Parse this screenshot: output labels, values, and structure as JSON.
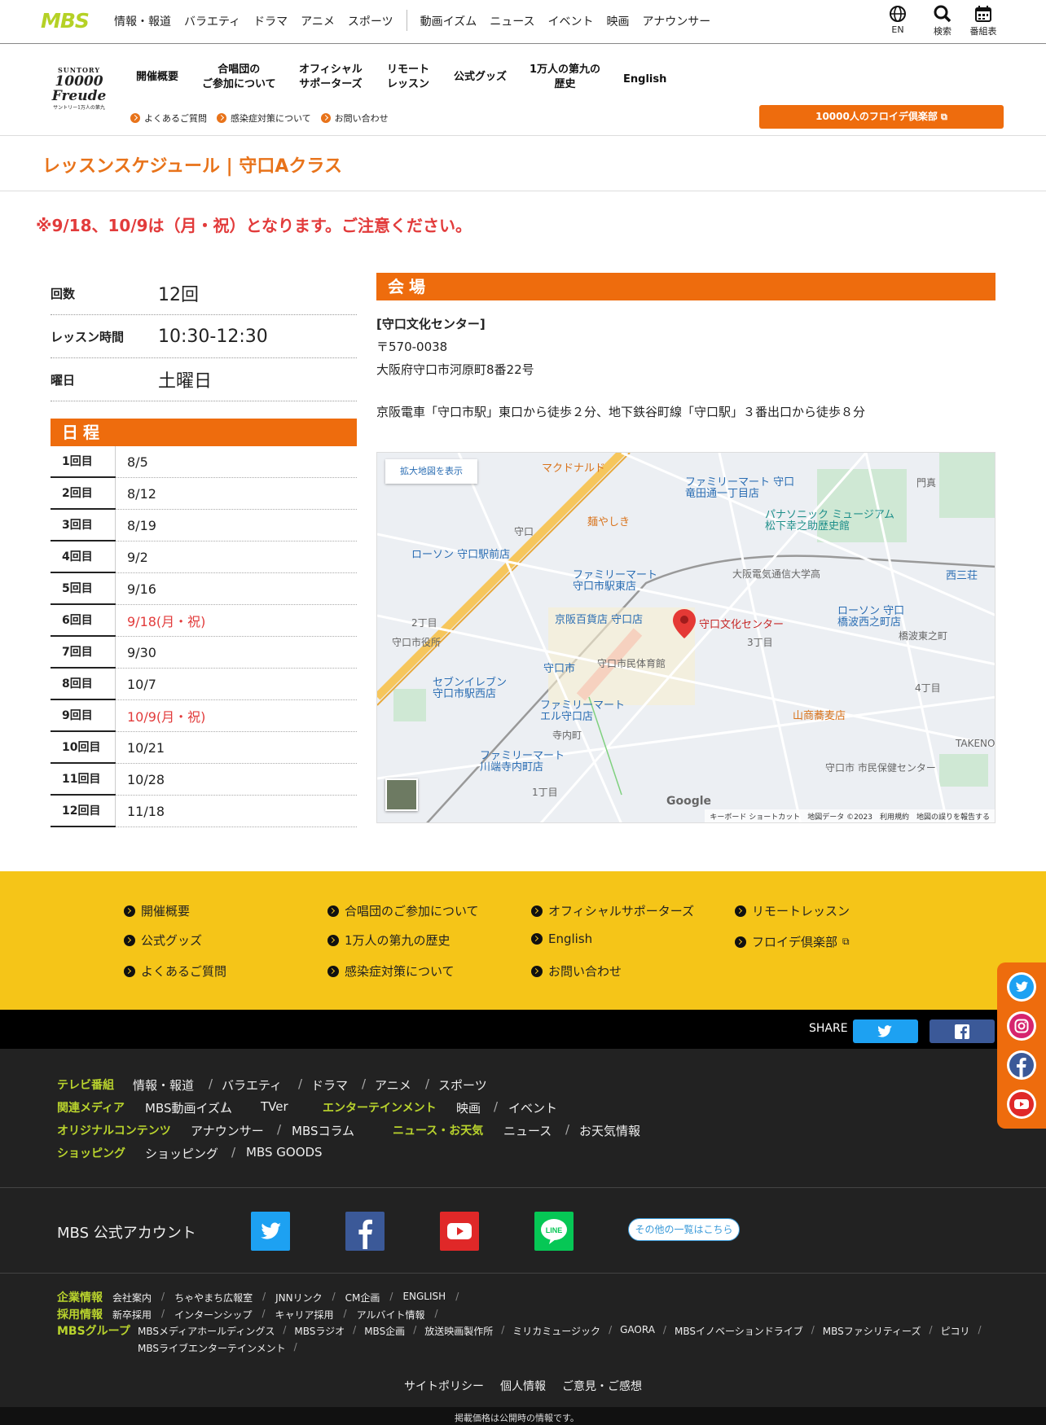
{
  "topbar": {
    "logo": "MBS",
    "nav": [
      "情報・報道",
      "バラエティ",
      "ドラマ",
      "アニメ",
      "スポーツ",
      "動画イズム",
      "ニュース",
      "イベント",
      "映画",
      "アナウンサー"
    ],
    "icons": [
      {
        "name": "globe-icon",
        "label": "EN"
      },
      {
        "name": "search-icon",
        "label": "検索"
      },
      {
        "name": "calendar-icon",
        "label": "番組表"
      }
    ]
  },
  "header": {
    "logo_top": "SUNTORY",
    "logo_main": "10000 Freude",
    "logo_sub": "サントリー1万人の第九",
    "nav": [
      "開催概要",
      "合唱団の\nご参加について",
      "オフィシャル\nサポーターズ",
      "リモート\nレッスン",
      "公式グッズ",
      "1万人の第九の\n歴史",
      "English"
    ],
    "subnav": [
      "よくあるご質問",
      "感染症対策について",
      "お問い合わせ"
    ],
    "club_button": "10000人のフロイデ倶楽部"
  },
  "page": {
    "title": "レッスンスケジュール | 守口Aクラス",
    "notice": "※9/18、10/9は（月・祝）となります。ご注意ください。"
  },
  "info": [
    {
      "label": "回数",
      "value": "12回"
    },
    {
      "label": "レッスン時間",
      "value": "10:30-12:30"
    },
    {
      "label": "曜日",
      "value": "土曜日"
    }
  ],
  "schedule": {
    "heading": "日程",
    "rows": [
      {
        "n": "1回目",
        "d": "8/5",
        "holiday": false
      },
      {
        "n": "2回目",
        "d": "8/12",
        "holiday": false
      },
      {
        "n": "3回目",
        "d": "8/19",
        "holiday": false
      },
      {
        "n": "4回目",
        "d": "9/2",
        "holiday": false
      },
      {
        "n": "5回目",
        "d": "9/16",
        "holiday": false
      },
      {
        "n": "6回目",
        "d": "9/18(月・祝)",
        "holiday": true
      },
      {
        "n": "7回目",
        "d": "9/30",
        "holiday": false
      },
      {
        "n": "8回目",
        "d": "10/7",
        "holiday": false
      },
      {
        "n": "9回目",
        "d": "10/9(月・祝)",
        "holiday": true
      },
      {
        "n": "10回目",
        "d": "10/21",
        "holiday": false
      },
      {
        "n": "11回目",
        "d": "10/28",
        "holiday": false
      },
      {
        "n": "12回目",
        "d": "11/18",
        "holiday": false
      }
    ]
  },
  "venue": {
    "heading": "会場",
    "name": "[守口文化センター]",
    "postal": "〒570-0038",
    "address": "大阪府守口市河原町8番22号",
    "access": "京阪電車「守口市駅」東口から徒歩２分、地下鉄谷町線「守口駅」３番出口から徒歩８分"
  },
  "map": {
    "enlarge": "拡大地図を表示",
    "marker": "守口文化センター",
    "labels": [
      "マクドナルド",
      "ファミリーマート 守口\n竜田通一丁目店",
      "門真",
      "麺やしき",
      "守口",
      "ローソン 守口駅前店",
      "パナソニック ミュージアム\n松下幸之助歴史館",
      "大阪電気通信大学高",
      "ファミリーマート\n守口市駅東店",
      "京阪百貨店 守口店",
      "守口市役所",
      "ローソン 守口\n橋波西之町店",
      "橋波東之町",
      "守口市",
      "守口市民体育館",
      "セブンイレブン\n守口市駅西店",
      "ファミリーマート\nエル守口店",
      "寺内町",
      "山商蕎麦店",
      "ファミリーマート\n川端寺内町店",
      "守口市 市民保健センター",
      "TAKENOKO",
      "西三荘",
      "2丁目",
      "3丁目",
      "1丁目",
      "4丁目",
      "Google"
    ],
    "footer": "キーボード ショートカット　地図データ ©2023　利用規約　地図の誤りを報告する"
  },
  "yellow_footer": {
    "links": [
      "開催概要",
      "合唱団のご参加について",
      "オフィシャルサポーターズ",
      "リモートレッスン",
      "公式グッズ",
      "1万人の第九の歴史",
      "English",
      "フロイデ倶楽部",
      "よくあるご質問",
      "感染症対策について",
      "お問い合わせ"
    ]
  },
  "share": {
    "label": "SHARE"
  },
  "dark_footer": {
    "tv": {
      "label": "テレビ番組",
      "items": [
        "情報・報道",
        "バラエティ",
        "ドラマ",
        "アニメ",
        "スポーツ"
      ]
    },
    "media": {
      "label": "関連メディア",
      "items": [
        "MBS動画イズム",
        "TVer"
      ]
    },
    "ent": {
      "label": "エンターテインメント",
      "items": [
        "映画",
        "イベント"
      ]
    },
    "orig": {
      "label": "オリジナルコンテンツ",
      "items": [
        "アナウンサー",
        "MBSコラム"
      ]
    },
    "news": {
      "label": "ニュース・お天気",
      "items": [
        "ニュース",
        "お天気情報"
      ]
    },
    "shop": {
      "label": "ショッピング",
      "items": [
        "ショッピング",
        "MBS GOODS"
      ]
    },
    "accounts_label": "MBS 公式アカウント",
    "other_button": "その他の一覧はこちら",
    "corp": {
      "label": "企業情報",
      "items": [
        "会社案内",
        "ちゃやまち広報室",
        "JNNリンク",
        "CM企画",
        "ENGLISH"
      ]
    },
    "recruit": {
      "label": "採用情報",
      "items": [
        "新卒採用",
        "インターンシップ",
        "キャリア採用",
        "アルバイト情報"
      ]
    },
    "group": {
      "label": "MBSグループ",
      "items": [
        "MBSメディアホールディングス",
        "MBSラジオ",
        "MBS企画",
        "放送映画製作所",
        "ミリカミュージック",
        "GAORA",
        "MBSイノベーションドライブ",
        "MBSファシリティーズ",
        "ピコリ",
        "MBSライブエンターテインメント"
      ]
    },
    "policy": [
      "サイトポリシー",
      "個人情報",
      "ご意見・ご感想"
    ],
    "bottom_note": "掲載価格は公開時の情報です。"
  }
}
